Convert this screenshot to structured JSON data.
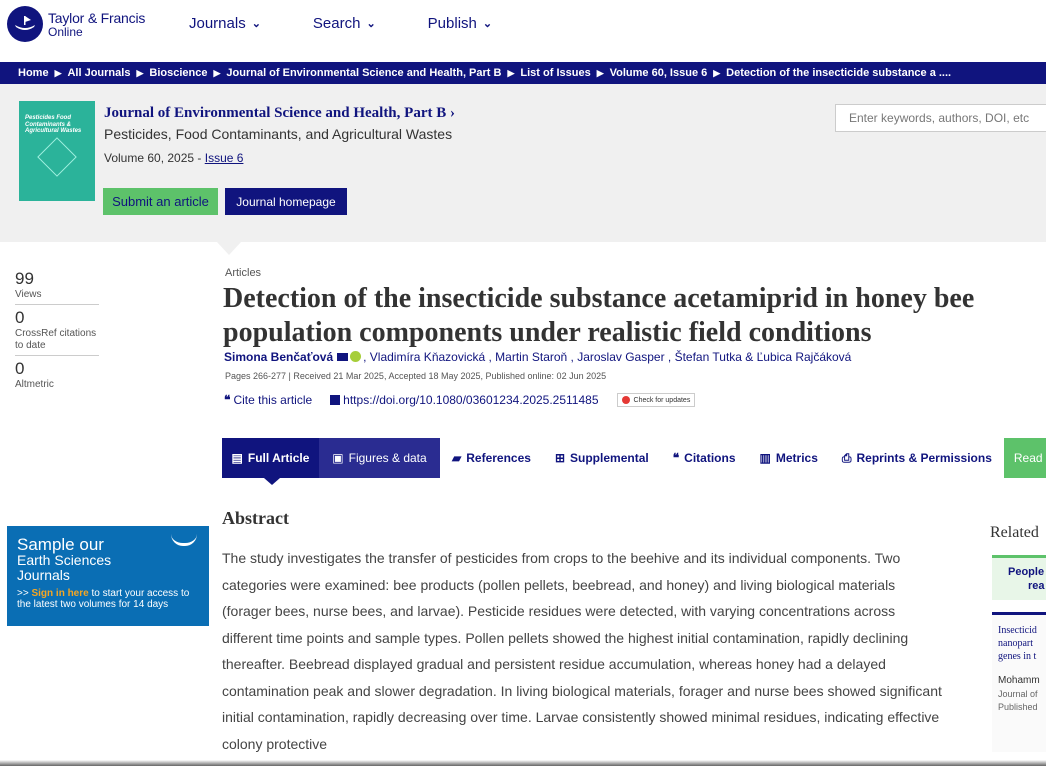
{
  "header": {
    "logo_line1": "Taylor & Francis",
    "logo_line2": "Online",
    "nav": [
      "Journals",
      "Search",
      "Publish"
    ]
  },
  "breadcrumb": [
    "Home",
    "All Journals",
    "Bioscience",
    "Journal of Environmental Science and Health, Part B",
    "List of Issues",
    "Volume 60, Issue 6",
    "Detection of the insecticide substance a ...."
  ],
  "journal": {
    "cover_text": "Pesticides Food Contaminants & Agricultural Wastes",
    "title": "Journal of Environmental Science and Health, Part B ›",
    "subtitle": "Pesticides, Food Contaminants, and Agricultural Wastes",
    "volume": "Volume 60, 2025 - ",
    "issue": "Issue 6",
    "submit_label": "Submit an article",
    "home_label": "Journal homepage",
    "search_placeholder": "Enter keywords, authors, DOI, etc"
  },
  "metrics": [
    {
      "value": "99",
      "label": "Views"
    },
    {
      "value": "0",
      "label": "CrossRef citations to date"
    },
    {
      "value": "0",
      "label": "Altmetric"
    }
  ],
  "article": {
    "kind": "Articles",
    "title": "Detection of the insecticide substance acetamiprid in honey bee population components under realistic field conditions",
    "first_author": "Simona Benčaťová",
    "other_authors": ", Vladimíra Kňazovická , Martin Staroň , Jaroslav Gasper , Štefan Tutka & Ľubica Rajčáková",
    "pages": "Pages 266-277 | Received 21 Mar 2025, Accepted 18 May 2025, Published online: 02 Jun 2025",
    "cite_label": "Cite this article",
    "doi": "https://doi.org/10.1080/03601234.2025.2511485",
    "check_label": "Check for updates"
  },
  "tabs": [
    {
      "label": "Full Article",
      "icon": "file-icon",
      "glyph": "▤"
    },
    {
      "label": "Figures & data",
      "icon": "image-icon",
      "glyph": "▣"
    },
    {
      "label": "References",
      "icon": "book-icon",
      "glyph": "▰"
    },
    {
      "label": "Supplemental",
      "icon": "plus-icon",
      "glyph": "⊞"
    },
    {
      "label": "Citations",
      "icon": "quote-icon",
      "glyph": "❝"
    },
    {
      "label": "Metrics",
      "icon": "bar-chart-icon",
      "glyph": "▥"
    },
    {
      "label": "Reprints & Permissions",
      "icon": "print-icon",
      "glyph": "⎙"
    },
    {
      "label": "Read",
      "icon": "",
      "glyph": ""
    }
  ],
  "abstract": {
    "heading": "Abstract",
    "text": "The study investigates the transfer of pesticides from crops to the beehive and its individual components. Two categories were examined: bee products (pollen pellets, beebread, and honey) and living biological materials (forager bees, nurse bees, and larvae). Pesticide residues were detected, with varying concentrations across different time points and sample types. Pollen pellets showed the highest initial contamination, rapidly declining thereafter. Beebread displayed gradual and persistent residue accumulation, whereas honey had a delayed contamination peak and slower degradation. In living biological materials, forager and nurse bees showed significant initial contamination, rapidly decreasing over time. Larvae consistently showed minimal residues, indicating effective colony protective"
  },
  "ad": {
    "line1": "Sample our",
    "line2": "Earth Sciences",
    "line3": "Journals",
    "prefix": ">> ",
    "signin": "Sign in here",
    "rest": " to start your access to the latest two volumes for 14 days"
  },
  "related": {
    "heading": "Related",
    "people_line1": "People",
    "people_line2": "rea",
    "card_title_lines": [
      "Insecticid",
      "nanopart",
      "genes in t"
    ],
    "card_author": "Mohamm",
    "card_journal": "Journal of",
    "card_published": "Published"
  }
}
